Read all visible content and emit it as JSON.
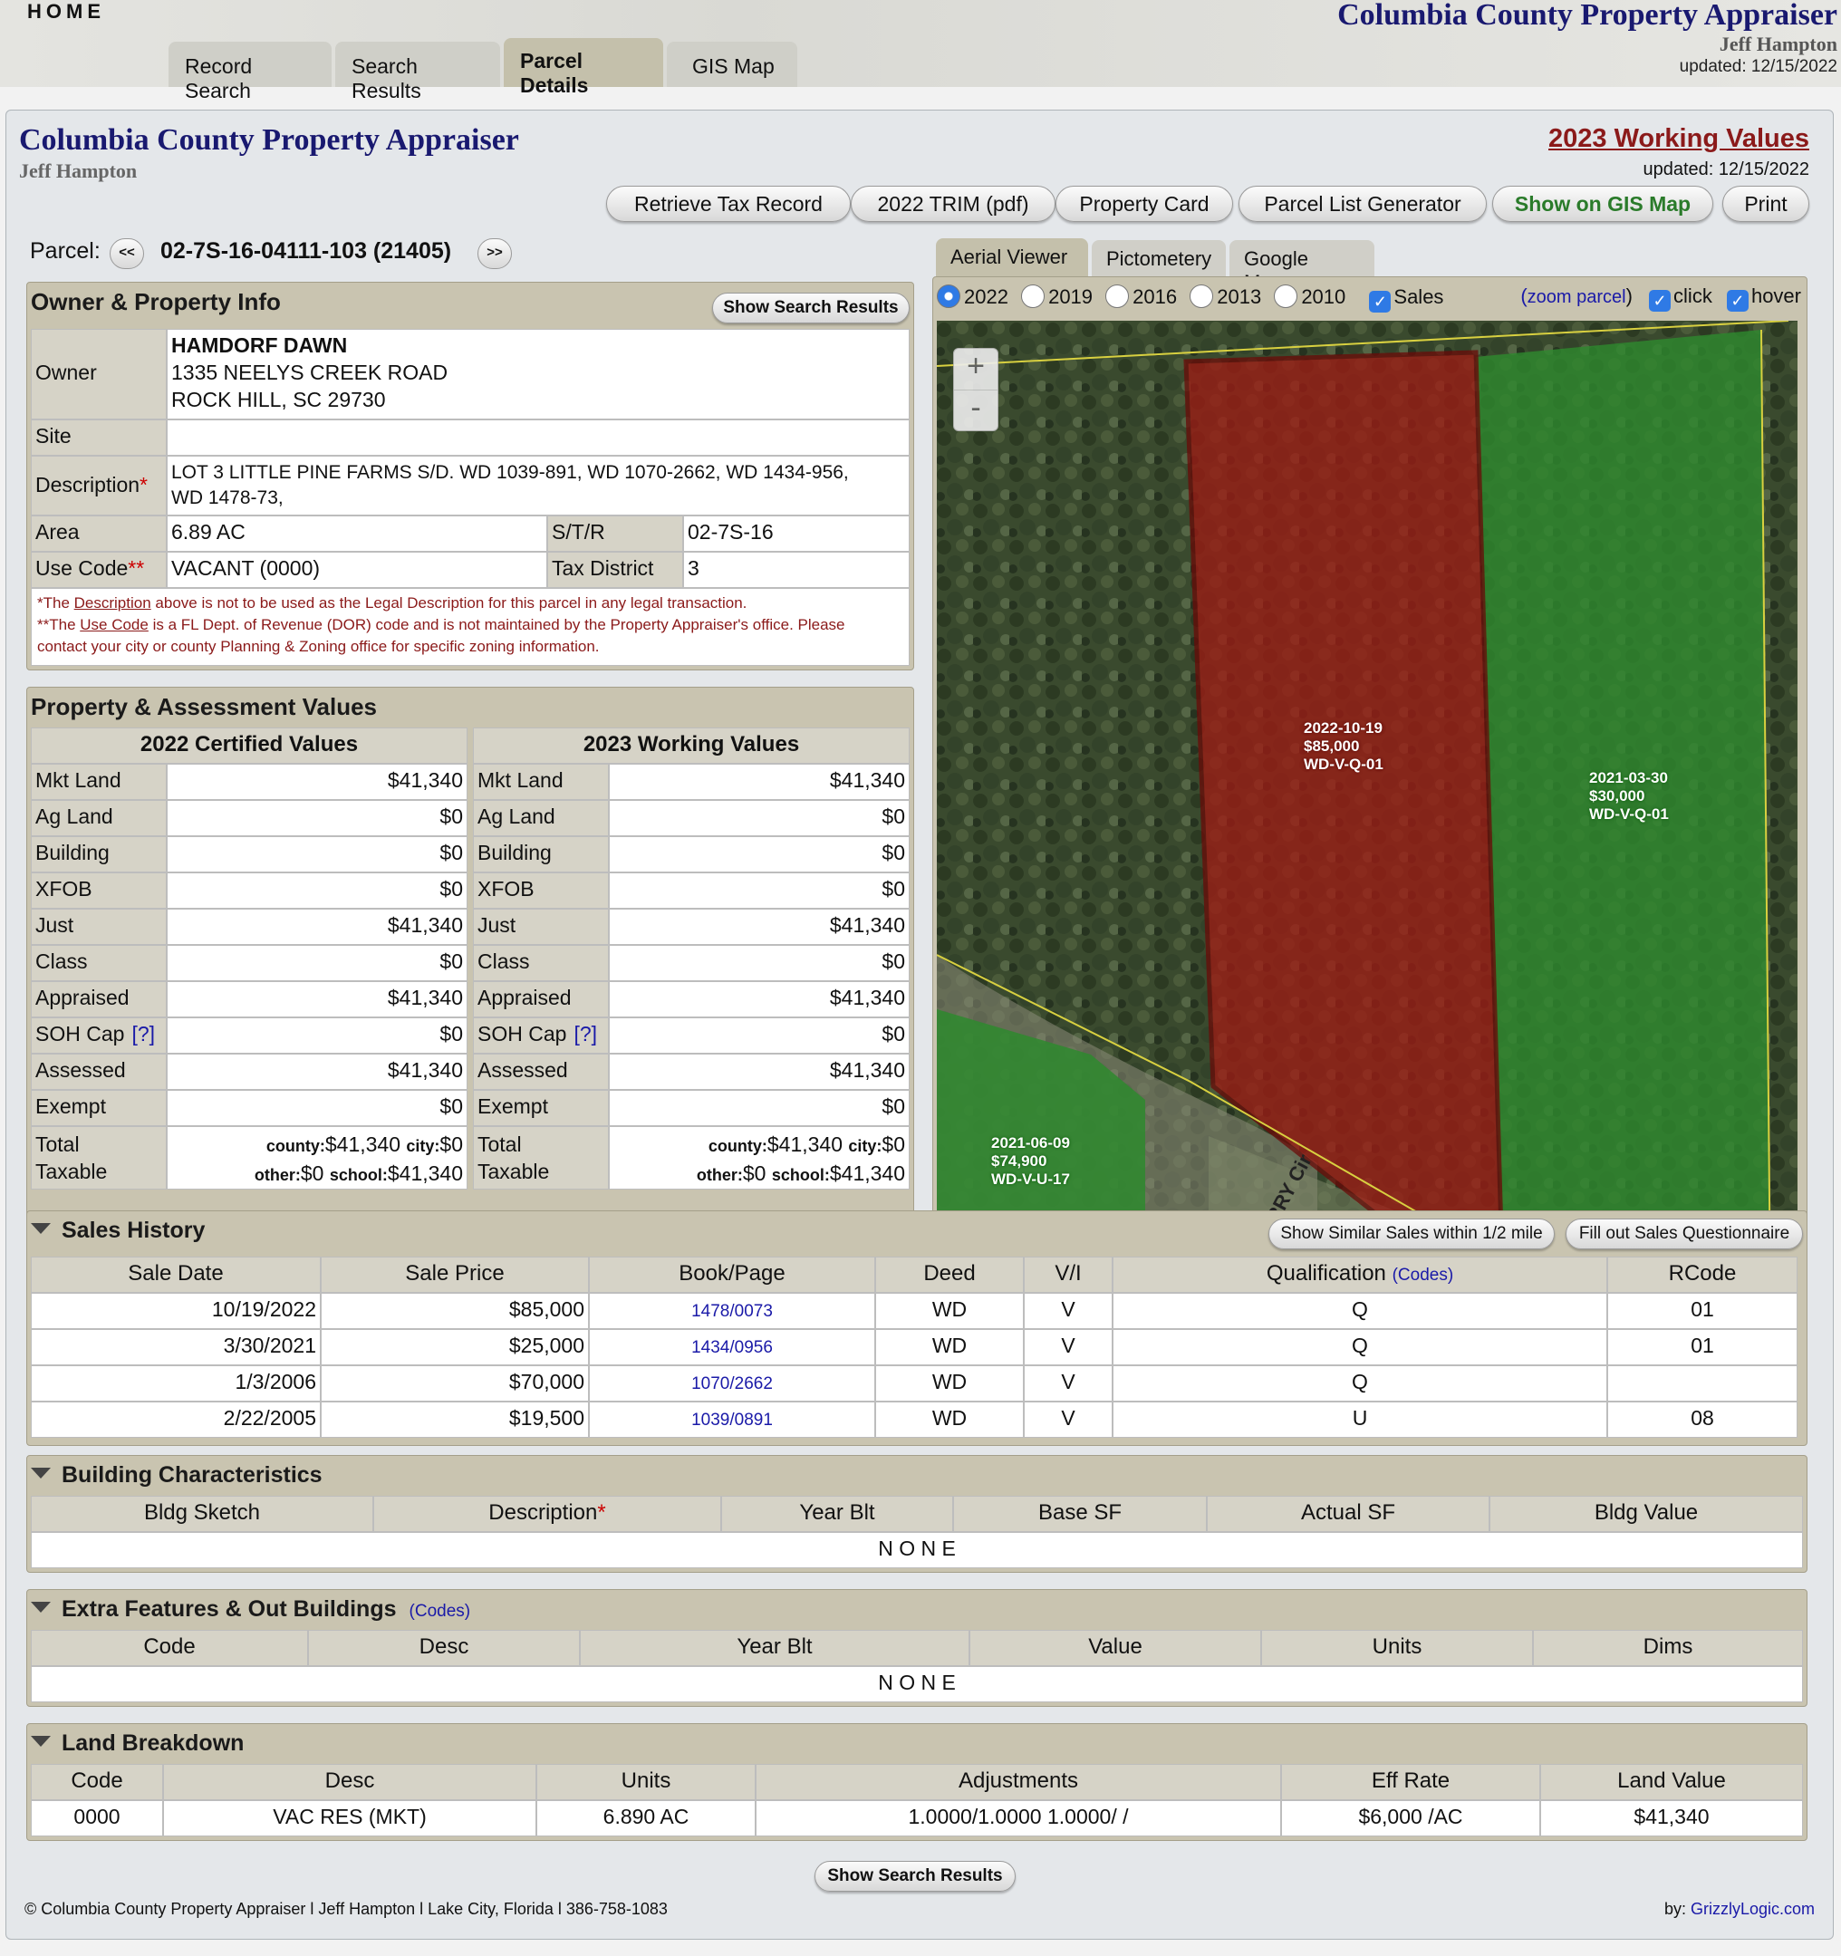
{
  "header": {
    "home": "HOME",
    "tabs": [
      "Record Search",
      "Search Results",
      "Parcel Details",
      "GIS Map"
    ],
    "title": "Columbia County Property Appraiser",
    "subtitle": "Jeff Hampton",
    "updated": "updated: 12/15/2022"
  },
  "page": {
    "title": "Columbia County Property Appraiser",
    "subtitle": "Jeff Hampton",
    "working_values_link": "2023 Working Values",
    "updated": "updated: 12/15/2022"
  },
  "toolbar": {
    "retrieve": "Retrieve Tax Record",
    "trim": "2022 TRIM (pdf)",
    "card": "Property Card",
    "list": "Parcel List Generator",
    "gis": "Show on GIS Map",
    "print": "Print"
  },
  "parcel": {
    "label": "Parcel:",
    "prev": "<<",
    "next": ">>",
    "id": "02-7S-16-04111-103 (21405)"
  },
  "owner_info": {
    "title": "Owner & Property Info",
    "button": "Show Search Results",
    "owner_label": "Owner",
    "owner_name": "HAMDORF DAWN",
    "owner_addr1": "1335 NEELYS CREEK ROAD",
    "owner_addr2": "ROCK HILL, SC 29730",
    "site_label": "Site",
    "site_value": "",
    "desc_label": "Description",
    "desc_value1": "LOT 3 LITTLE PINE FARMS S/D. WD 1039-891, WD 1070-2662, WD 1434-956,",
    "desc_value2": "WD 1478-73,",
    "area_label": "Area",
    "area_value": "6.89 AC",
    "str_label": "S/T/R",
    "str_value": "02-7S-16",
    "use_label": "Use Code",
    "use_value": "VACANT (0000)",
    "tax_label": "Tax District",
    "tax_value": "3",
    "note1_a": "*The ",
    "note1_link": "Description",
    "note1_b": " above is not to be used as the Legal Description for this parcel in any legal transaction.",
    "note2_a": "**The ",
    "note2_link": "Use Code",
    "note2_b": " is a FL Dept. of Revenue (DOR) code and is not maintained by the Property Appraiser's office. Please",
    "note3": "contact your city or county Planning & Zoning office for specific zoning information."
  },
  "values": {
    "title": "Property & Assessment Values",
    "col1": "2022 Certified Values",
    "col2": "2023 Working Values",
    "rows": [
      {
        "label": "Mkt Land",
        "v2022": "$41,340",
        "v2023": "$41,340"
      },
      {
        "label": "Ag Land",
        "v2022": "$0",
        "v2023": "$0"
      },
      {
        "label": "Building",
        "v2022": "$0",
        "v2023": "$0"
      },
      {
        "label": "XFOB",
        "v2022": "$0",
        "v2023": "$0"
      },
      {
        "label": "Just",
        "v2022": "$41,340",
        "v2023": "$41,340"
      },
      {
        "label": "Class",
        "v2022": "$0",
        "v2023": "$0"
      },
      {
        "label": "Appraised",
        "v2022": "$41,340",
        "v2023": "$41,340"
      },
      {
        "label": "SOH Cap",
        "v2022": "$0",
        "v2023": "$0"
      },
      {
        "label": "Assessed",
        "v2022": "$41,340",
        "v2023": "$41,340"
      },
      {
        "label": "Exempt",
        "v2022": "$0",
        "v2023": "$0"
      }
    ],
    "soh_help": "[?]",
    "total_label1": "Total",
    "total_label2": "Taxable",
    "county_lbl": "county:",
    "county_val": "$41,340",
    "city_lbl": "city:",
    "city_val": "$0",
    "other_lbl": "other:",
    "other_val": "$0",
    "school_lbl": "school:",
    "school_val": "$41,340"
  },
  "map": {
    "tabs": [
      "Aerial Viewer",
      "Pictometery",
      "Google Maps"
    ],
    "years": [
      "2022",
      "2019",
      "2016",
      "2013",
      "2010"
    ],
    "sales": "Sales",
    "zoom_parcel": "zoom parcel",
    "click": "click",
    "hover": "hover",
    "zoom_in": "+",
    "zoom_out": "-",
    "labels": [
      {
        "date": "2022-10-19",
        "price": "$85,000",
        "code": "WD-V-Q-01"
      },
      {
        "date": "2021-03-30",
        "price": "$30,000",
        "code": "WD-V-Q-01"
      },
      {
        "date": "2021-06-09",
        "price": "$74,900",
        "code": "WD-V-U-17"
      }
    ],
    "road": "RRY Cir",
    "colors": {
      "subject": "#a01a14",
      "neighbor": "#2e8a2e"
    }
  },
  "sales": {
    "title": "Sales History",
    "similar": "Show Similar Sales within 1/2 mile",
    "questionnaire": "Fill out Sales Questionnaire",
    "headers": [
      "Sale Date",
      "Sale Price",
      "Book/Page",
      "Deed",
      "V/I",
      "Qualification",
      "RCode"
    ],
    "codes": "(Codes)",
    "rows": [
      {
        "date": "10/19/2022",
        "price": "$85,000",
        "book": "1478/0073",
        "deed": "WD",
        "vi": "V",
        "q": "Q",
        "rcode": "01"
      },
      {
        "date": "3/30/2021",
        "price": "$25,000",
        "book": "1434/0956",
        "deed": "WD",
        "vi": "V",
        "q": "Q",
        "rcode": "01"
      },
      {
        "date": "1/3/2006",
        "price": "$70,000",
        "book": "1070/2662",
        "deed": "WD",
        "vi": "V",
        "q": "Q",
        "rcode": ""
      },
      {
        "date": "2/22/2005",
        "price": "$19,500",
        "book": "1039/0891",
        "deed": "WD",
        "vi": "V",
        "q": "U",
        "rcode": "08"
      }
    ]
  },
  "building": {
    "title": "Building Characteristics",
    "headers": [
      "Bldg Sketch",
      "Description",
      "Year Blt",
      "Base SF",
      "Actual SF",
      "Bldg Value"
    ],
    "none": "N O N E"
  },
  "extra": {
    "title": "Extra Features & Out Buildings",
    "codes": "(Codes)",
    "headers": [
      "Code",
      "Desc",
      "Year Blt",
      "Value",
      "Units",
      "Dims"
    ],
    "none": "N O N E"
  },
  "land": {
    "title": "Land Breakdown",
    "headers": [
      "Code",
      "Desc",
      "Units",
      "Adjustments",
      "Eff Rate",
      "Land Value"
    ],
    "row": [
      "0000",
      "VAC RES (MKT)",
      "6.890 AC",
      "1.0000/1.0000 1.0000/ /",
      "$6,000 /AC",
      "$41,340"
    ]
  },
  "footer": {
    "button": "Show Search Results",
    "copyright": "© Columbia County Property Appraiser l Jeff Hampton l Lake City, Florida l 386-758-1083",
    "by": "by: ",
    "by_link": "GrizzlyLogic.com"
  }
}
